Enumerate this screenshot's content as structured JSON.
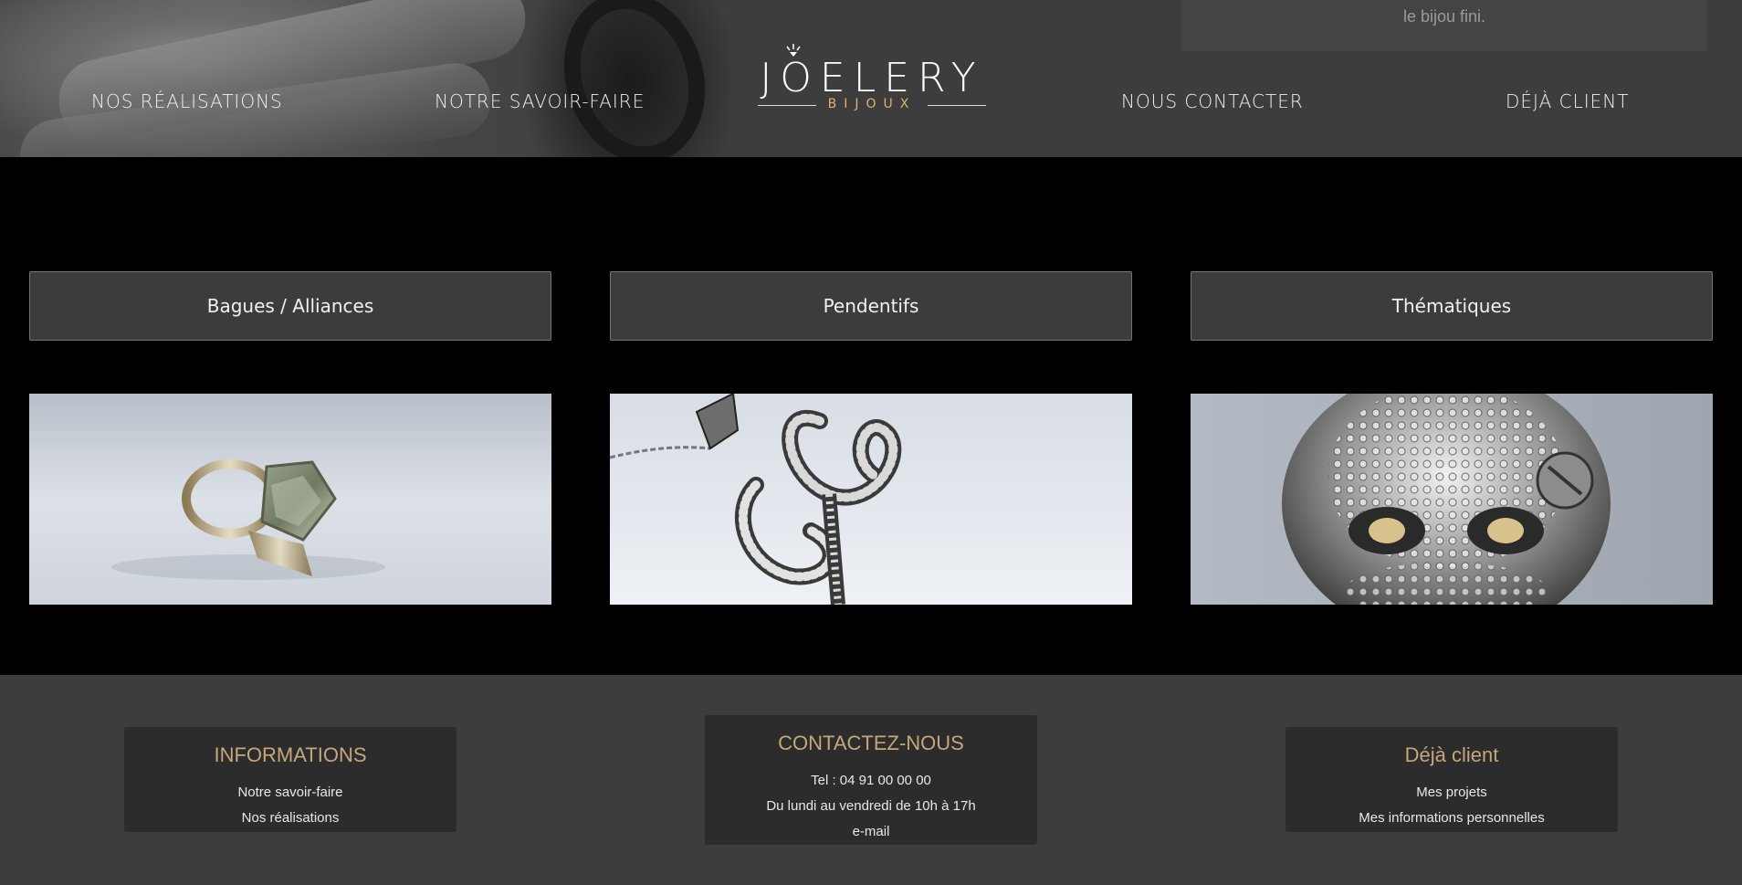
{
  "header": {
    "caption_text": "le bijou fini.",
    "nav": {
      "realisations": "NOS RÉALISATIONS",
      "savoir_faire": "NOTRE SAVOIR-FAIRE",
      "contact": "NOUS CONTACTER",
      "client": "DÉJÀ CLIENT"
    },
    "logo": {
      "word": "JOELERY",
      "sub": "BIJOUX"
    }
  },
  "categories": [
    {
      "label": "Bagues / Alliances",
      "image": "ring-with-green-gem"
    },
    {
      "label": "Pendentifs",
      "image": "letter-pendant-with-diamonds"
    },
    {
      "label": "Thématiques",
      "image": "skull-ring-with-diamonds"
    }
  ],
  "footer": {
    "informations": {
      "title": "INFORMATIONS",
      "links": [
        "Notre savoir-faire",
        "Nos réalisations"
      ]
    },
    "contact": {
      "title": "CONTACTEZ-NOUS",
      "lines": [
        "Tel : 04 91 00 00 00",
        "Du lundi au vendredi de 10h à 17h",
        "e-mail"
      ]
    },
    "client": {
      "title": "Déjà client",
      "links": [
        "Mes projets",
        "Mes informations personnelles"
      ]
    }
  },
  "colors": {
    "header_bg": "#3d3d3d",
    "main_bg": "#000000",
    "button_bg": "#3c3c3c",
    "footer_title": "#c4a77a",
    "logo_accent": "#d9b46a"
  }
}
